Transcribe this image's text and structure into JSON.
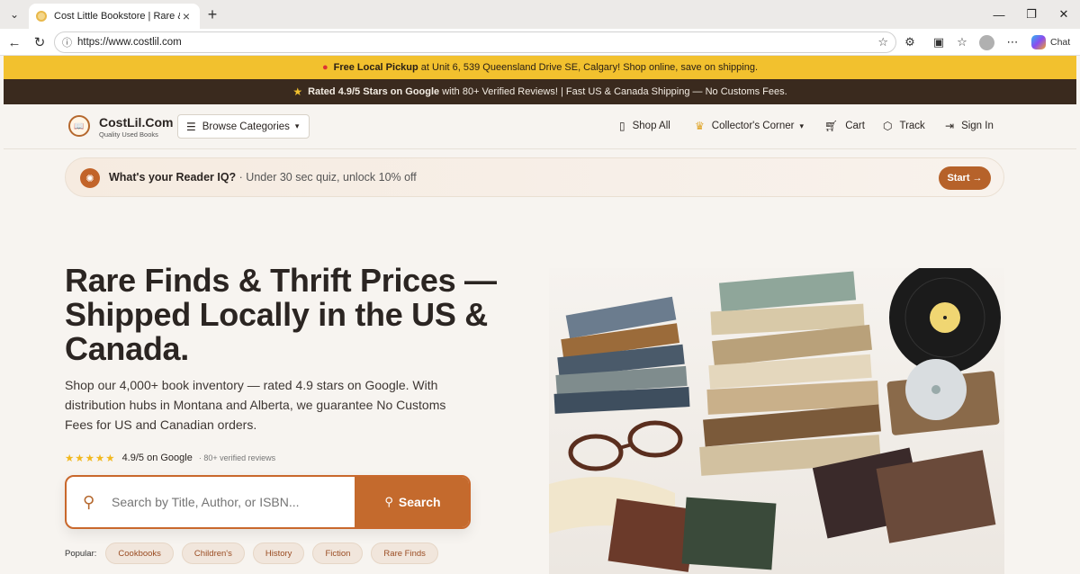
{
  "browser": {
    "tab_title": "Cost Little Bookstore | Rare & Colle",
    "url": "https://www.costlil.com",
    "chat_label": "Chat"
  },
  "promo": {
    "bold": "Free Local Pickup",
    "text": " at Unit 6, 539 Queensland Drive SE, Calgary! Shop online, save on shipping."
  },
  "rating_bar": {
    "bold": "Rated 4.9/5 Stars on Google",
    "text": " with 80+ Verified Reviews! | Fast US & Canada Shipping — No Customs Fees."
  },
  "header": {
    "brand_name": "CostLil.Com",
    "tagline": "Quality Used Books",
    "browse_label": "Browse Categories",
    "nav": {
      "shop_all": "Shop All",
      "collectors": "Collector's Corner",
      "cart": "Cart",
      "track": "Track",
      "sign_in": "Sign In"
    }
  },
  "quiz": {
    "title": "What's your Reader IQ?",
    "sub": " · Under 30 sec quiz, unlock 10% off",
    "start_label": "Start →"
  },
  "hero": {
    "title": "Rare Finds & Thrift Prices —Shipped Locally in the US & Canada.",
    "description": "Shop our 4,000+ book inventory — rated 4.9 stars on Google. With distribution hubs in Montana and Alberta, we guarantee No Customs Fees for US and Canadian orders.",
    "rating_text": "4.9/5 on Google",
    "reviews_text": "· 80+ verified reviews",
    "stars": 5
  },
  "search": {
    "placeholder": "Search by Title, Author, or ISBN...",
    "button_label": "Search"
  },
  "popular": {
    "label": "Popular:",
    "chips": [
      "Cookbooks",
      "Children's",
      "History",
      "Fiction",
      "Rare Finds"
    ]
  },
  "colors": {
    "promo_bg": "#f2c12e",
    "dark_bar": "#3a2a1e",
    "accent": "#c46a2d"
  }
}
